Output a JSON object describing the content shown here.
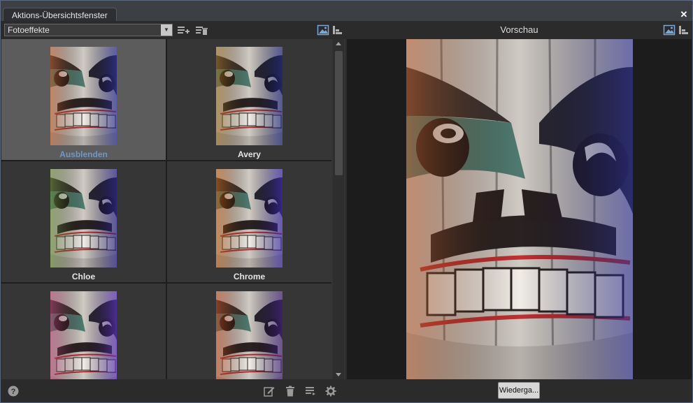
{
  "window": {
    "tab_title": "Aktions-Übersichtsfenster",
    "close_icon": "close-icon"
  },
  "left": {
    "category_select": {
      "value": "Fotoeffekte"
    },
    "toolbar_icons": [
      "add-list-icon",
      "delete-list-icon",
      "image-view-icon",
      "details-view-icon"
    ],
    "effects": [
      {
        "label": "Ausblenden",
        "selected": true,
        "tint": [
          "#b85a2a",
          "#2c2f9a"
        ]
      },
      {
        "label": "Avery",
        "selected": false,
        "tint": [
          "#a07020",
          "#202880"
        ]
      },
      {
        "label": "Chloe",
        "selected": false,
        "tint": [
          "#6a8a3a",
          "#2a2490"
        ]
      },
      {
        "label": "Chrome",
        "selected": false,
        "tint": [
          "#c06010",
          "#3a2ab0"
        ]
      },
      {
        "label": "",
        "selected": false,
        "tint": [
          "#b04070",
          "#5a30c0"
        ]
      },
      {
        "label": "",
        "selected": false,
        "tint": [
          "#c04a20",
          "#402080"
        ]
      }
    ],
    "bottom_icons": [
      "help-icon",
      "edit-icon",
      "trash-icon",
      "list-settings-icon",
      "gear-icon"
    ]
  },
  "right": {
    "title": "Vorschau",
    "header_icons": [
      "image-view-icon",
      "details-view-icon"
    ],
    "play_button": "Wiederga..."
  }
}
